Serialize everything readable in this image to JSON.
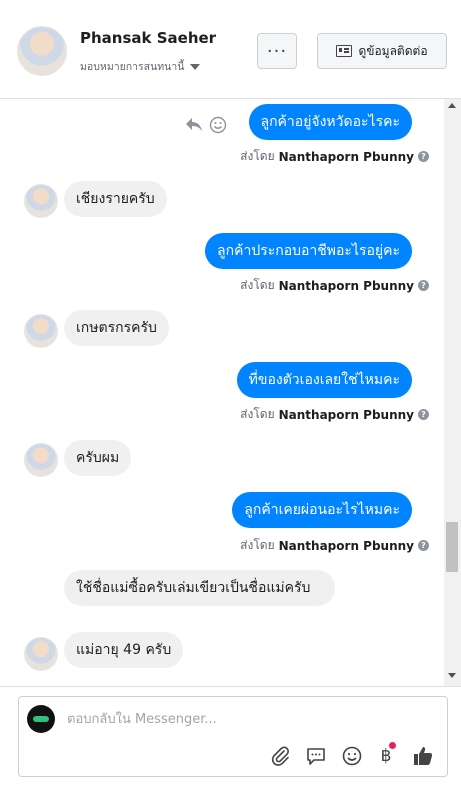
{
  "header": {
    "customer_name": "Phansak Saeher",
    "assign_label": "มอบหมายการสนทนานี้",
    "more_label": "···",
    "contact_info_label": "ดูข้อมูลติดต่อ"
  },
  "messages": [
    {
      "dir": "out",
      "text": "ลูกค้าอยู่จังหวัดอะไรคะ",
      "sent_prefix": "ส่งโดย",
      "sent_by": "Nanthaporn Pbunny"
    },
    {
      "dir": "in",
      "text": "เชียงรายครับ"
    },
    {
      "dir": "out",
      "text": "ลูกค้าประกอบอาชีพอะไรอยู่คะ",
      "sent_prefix": "ส่งโดย",
      "sent_by": "Nanthaporn Pbunny"
    },
    {
      "dir": "in",
      "text": "เกษตรกรครับ"
    },
    {
      "dir": "out",
      "text": "ที่ของตัวเองเลยใช่ไหมคะ",
      "sent_prefix": "ส่งโดย",
      "sent_by": "Nanthaporn Pbunny"
    },
    {
      "dir": "in",
      "text": "ครับผม"
    },
    {
      "dir": "out",
      "text": "ลูกค้าเคยผ่อนอะไรไหมคะ",
      "sent_prefix": "ส่งโดย",
      "sent_by": "Nanthaporn Pbunny"
    },
    {
      "dir": "in",
      "text": "ใช้ชื่อแม่ซื้อครับเล่มเขียวเป็นชื่อแม่ครับ"
    },
    {
      "dir": "in",
      "text": "แม่อายุ 49 ครับ"
    }
  ],
  "composer": {
    "placeholder": "ตอบกลับใน Messenger...",
    "currency_symbol": "฿"
  },
  "colors": {
    "outgoing_bubble": "#0084ff",
    "incoming_bubble": "#f1f0f0",
    "notification_dot": "#e0245e"
  },
  "icons": [
    "reply-icon",
    "emoji-icon",
    "attachment-icon",
    "saved-reply-icon",
    "emoji-picker-icon",
    "payment-icon",
    "thumbs-up-icon",
    "info-icon"
  ]
}
